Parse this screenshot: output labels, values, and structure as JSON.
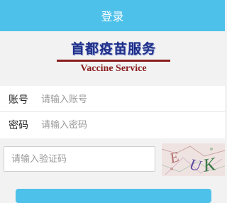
{
  "header": {
    "title": "登录"
  },
  "logo": {
    "cn": "首都疫苗服务",
    "en": "Vaccine Service"
  },
  "form": {
    "account_label": "账号",
    "account_placeholder": "请输入账号",
    "password_label": "密码",
    "password_placeholder": "请输入密码",
    "captcha_placeholder": "请输入验证码"
  },
  "captcha": {
    "text": "EUK"
  },
  "colors": {
    "accent": "#4ec1ea",
    "logo_blue": "#1f2f8a",
    "logo_red": "#8a1d1d"
  }
}
